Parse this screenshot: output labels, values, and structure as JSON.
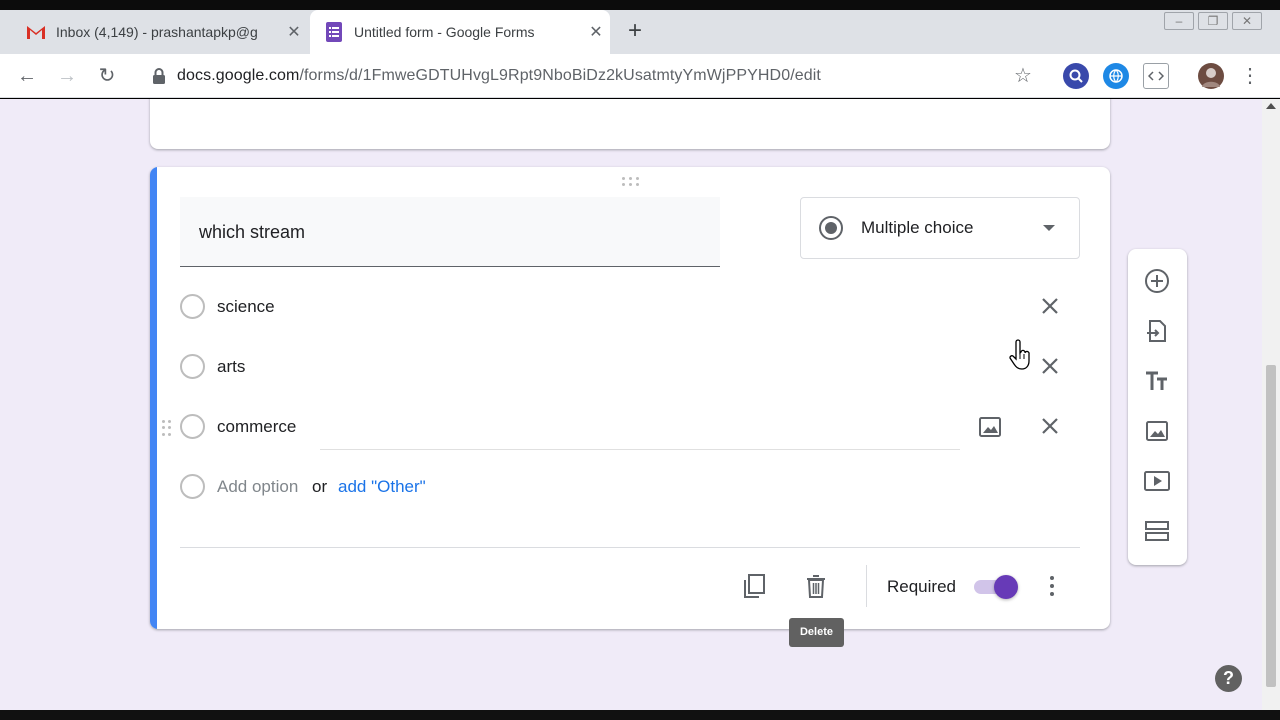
{
  "browser": {
    "tabs": [
      {
        "title": "Inbox (4,149) - prashantapkp@g",
        "icon": "gmail-icon",
        "active": false
      },
      {
        "title": "Untitled form - Google Forms",
        "icon": "google-forms-icon",
        "active": true
      }
    ],
    "new_tab_label": "+",
    "url": {
      "host": "docs.google.com",
      "path": "/forms/d/1FmweGDTUHvgL9Rpt9NboBiDz2kUsatmtyYmWjPPYHD0/edit"
    }
  },
  "question": {
    "title": "which stream",
    "type_label": "Multiple choice",
    "options": [
      "science",
      "arts",
      "commerce"
    ],
    "add_option_label": "Add option",
    "or_label": "or",
    "add_other_label": "add \"Other\"",
    "required_label": "Required",
    "required": true,
    "tooltip": "Delete"
  },
  "help_label": "?",
  "colors": {
    "accent": "#673ab7",
    "card_highlight": "#4285f4",
    "page_bg": "#f0ebf8",
    "link": "#1a73e8"
  }
}
